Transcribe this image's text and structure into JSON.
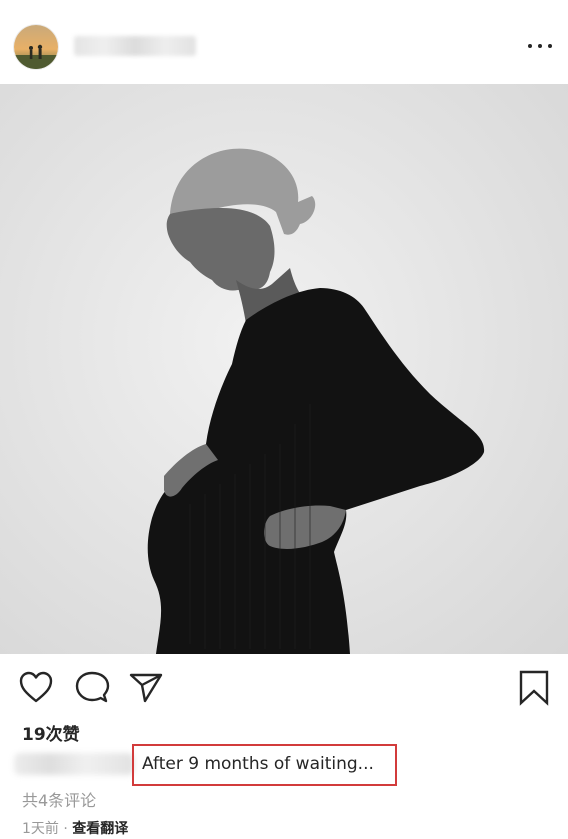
{
  "post": {
    "likes": "19次赞",
    "caption": "After 9 months of waiting...",
    "comments": "共4条评论",
    "time": "1天前",
    "separator": "·",
    "translate": "查看翻译"
  },
  "icons": {
    "more": "more-options-icon",
    "like": "heart-icon",
    "comment": "comment-icon",
    "share": "send-icon",
    "save": "bookmark-icon"
  },
  "colors": {
    "text": "#262626",
    "muted": "#999999",
    "highlight_box": "#d23b3b"
  }
}
